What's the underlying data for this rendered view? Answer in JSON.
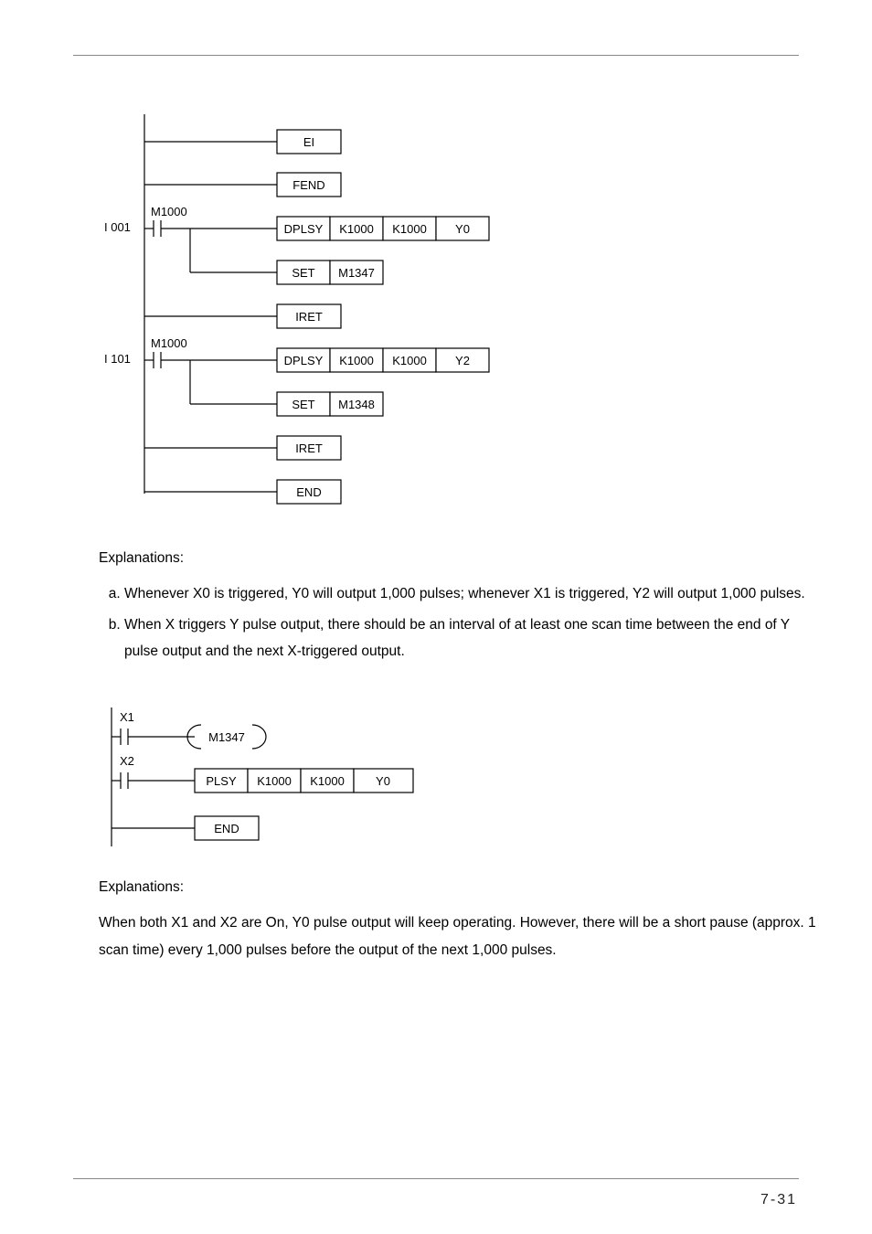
{
  "page_number": "7-31",
  "diagram1": {
    "rungs": [
      {
        "label": "",
        "contact": "",
        "blocks": [
          "EI"
        ]
      },
      {
        "label": "",
        "contact": "",
        "blocks": [
          "FEND"
        ]
      },
      {
        "label": "I 001",
        "contact": "M1000",
        "blocks": [
          "DPLSY",
          "K1000",
          "K1000",
          "Y0"
        ]
      },
      {
        "label": "",
        "contact": "",
        "blocks": [
          "SET",
          "M1347"
        ]
      },
      {
        "label": "",
        "contact": "",
        "blocks": [
          "IRET"
        ]
      },
      {
        "label": "I 101",
        "contact": "M1000",
        "blocks": [
          "DPLSY",
          "K1000",
          "K1000",
          "Y2"
        ]
      },
      {
        "label": "",
        "contact": "",
        "blocks": [
          "SET",
          "M1348"
        ]
      },
      {
        "label": "",
        "contact": "",
        "blocks": [
          "IRET"
        ]
      },
      {
        "label": "",
        "contact": "",
        "blocks": [
          "END"
        ]
      }
    ]
  },
  "explanations1": {
    "heading": "Explanations:",
    "items": [
      "Whenever X0 is triggered, Y0 will output 1,000 pulses; whenever X1 is triggered, Y2 will output 1,000 pulses.",
      "When X triggers Y pulse output, there should be an interval of at least one scan time between the end of Y pulse output and the next X-triggered output."
    ]
  },
  "diagram2": {
    "rungs": [
      {
        "contact": "X1",
        "coil": "M1347"
      },
      {
        "contact": "X2",
        "blocks": [
          "PLSY",
          "K1000",
          "K1000",
          "Y0"
        ]
      },
      {
        "blocks": [
          "END"
        ]
      }
    ]
  },
  "explanations2": {
    "heading": "Explanations:",
    "text": "When both X1 and X2 are On, Y0 pulse output will keep operating. However, there will be a short pause (approx. 1 scan time) every 1,000 pulses before the output of the next 1,000 pulses."
  }
}
